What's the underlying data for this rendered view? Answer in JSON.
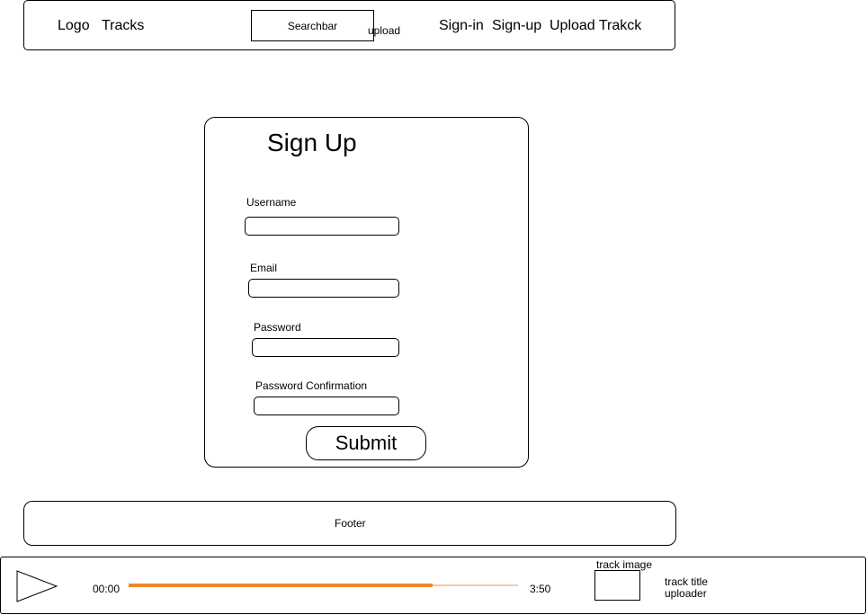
{
  "header": {
    "logo": "Logo",
    "tracks": "Tracks",
    "searchbar": "Searchbar",
    "upload": "upload",
    "sign_in": "Sign-in",
    "sign_up": "Sign-up",
    "upload_track": "Upload Trakck"
  },
  "signup_form": {
    "title": "Sign Up",
    "fields": [
      {
        "label": "Username",
        "value": ""
      },
      {
        "label": "Email",
        "value": ""
      },
      {
        "label": "Password",
        "value": ""
      },
      {
        "label": "Password Confirmation",
        "value": ""
      }
    ],
    "submit_label": "Submit"
  },
  "footer": {
    "text": "Footer"
  },
  "player": {
    "current_time": "00:00",
    "duration": "3:50",
    "progress_fraction": 0.78,
    "accent_color": "#f0882a",
    "track_image_label": "track image",
    "track_title": "track title",
    "uploader": "uploader",
    "play_icon": "play-icon"
  }
}
